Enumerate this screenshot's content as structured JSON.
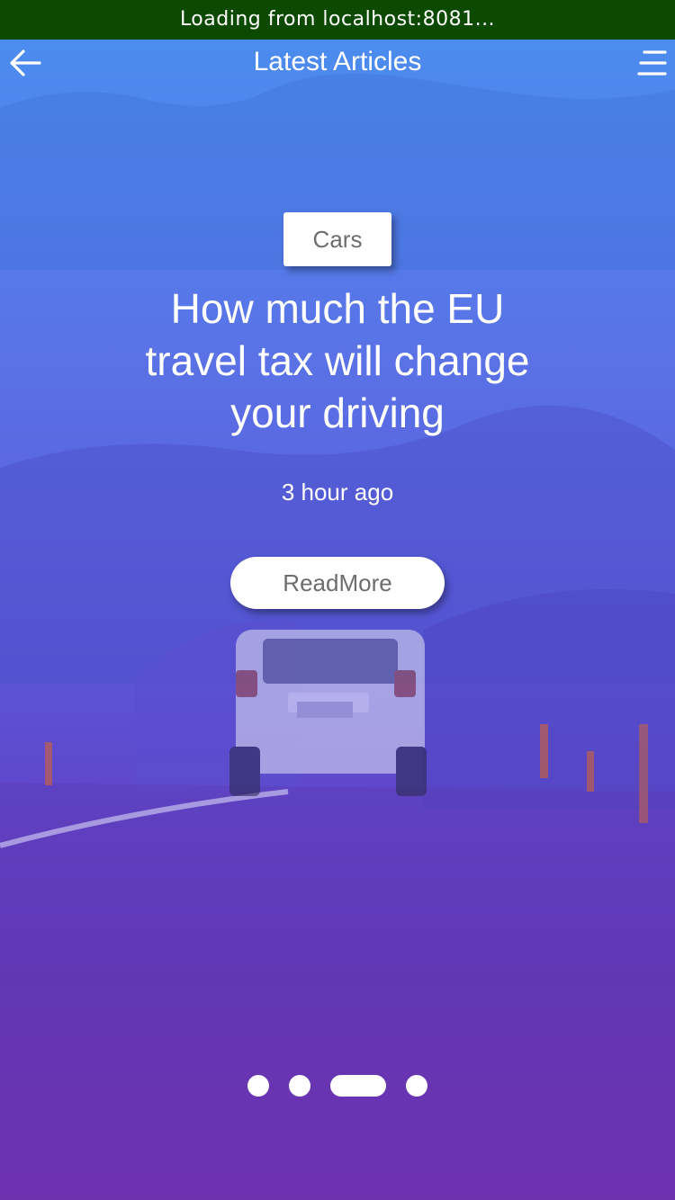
{
  "status_bar": {
    "text": "Loading from localhost:8081..."
  },
  "nav": {
    "title": "Latest Articles",
    "back_icon": "arrow-left-icon",
    "menu_icon": "hamburger-menu-icon"
  },
  "article": {
    "category": "Cars",
    "title": "How much the EU travel tax will change your driving",
    "time_ago": "3 hour ago",
    "read_more_label": "ReadMore"
  },
  "pager": {
    "total": 4,
    "active_index": 2
  },
  "colors": {
    "status_bar_bg": "#0b4a00",
    "gradient_top": "#4a8ff0",
    "gradient_bottom": "#7a28a8",
    "text_light": "#ffffff",
    "text_muted": "#6d6d6d"
  }
}
